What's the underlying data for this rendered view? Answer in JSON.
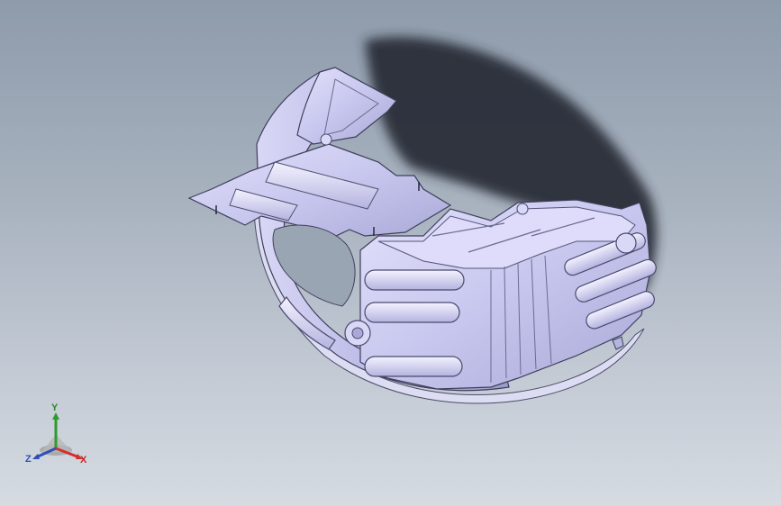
{
  "view": {
    "background_top": "#8e9bab",
    "background_bottom": "#d6dbe2",
    "part_color": "#c9c8ee",
    "shadow_color": "#2a2f38"
  },
  "triad": {
    "x_label": "X",
    "y_label": "Y",
    "z_label": "Z",
    "x_color": "#d32f2f",
    "y_color": "#2e9b2e",
    "z_color": "#2f4fb5"
  }
}
